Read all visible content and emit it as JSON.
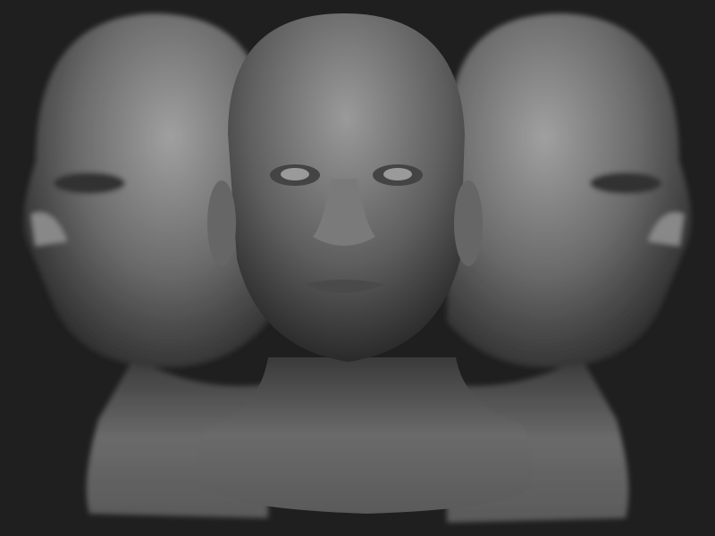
{
  "scene": {
    "background_color": "#1f1f1f",
    "surface_color": "#6e6e6e",
    "highlight_color": "#a8a8a8",
    "shadow_color": "#2e2e2e"
  }
}
